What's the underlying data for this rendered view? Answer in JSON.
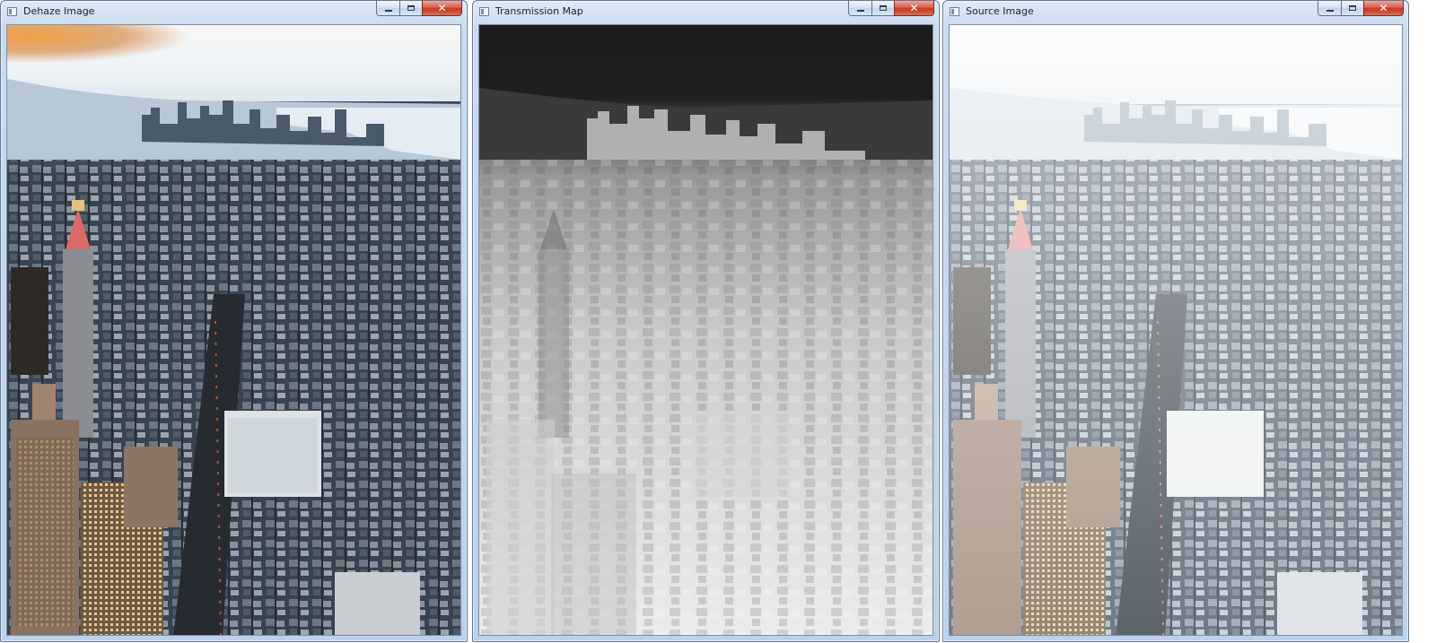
{
  "windows": {
    "dehaze": {
      "title": "Dehaze Image",
      "close_glyph": "✕"
    },
    "transmission": {
      "title": "Transmission Map",
      "close_glyph": "✕"
    },
    "source": {
      "title": "Source Image",
      "close_glyph": "✕"
    }
  },
  "icons": [
    "window-app-icon",
    "minimize-icon",
    "maximize-icon",
    "close-icon"
  ],
  "colors": {
    "frame_blue": "#bcd1ea",
    "close_red": "#c4371f",
    "dehaze_sky_glow": "#f0a040",
    "transmission_dark": "#1c1c1c",
    "transmission_light": "#e8e8e8",
    "source_haze": "#dfe6ee"
  }
}
